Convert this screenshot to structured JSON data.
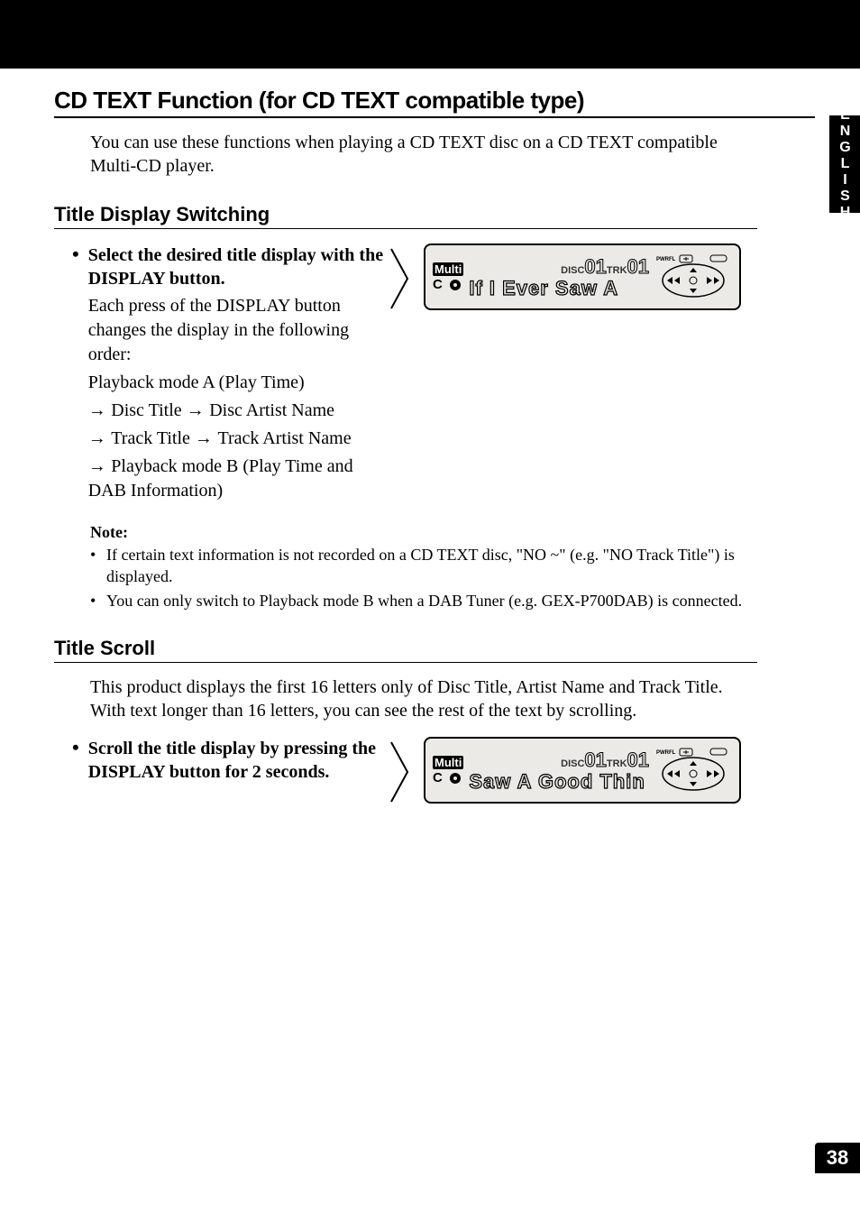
{
  "sidebar": {
    "language": "ENGLISH"
  },
  "page_number": "38",
  "main_heading": "CD TEXT Function (for CD TEXT compatible type)",
  "intro": "You can use these functions when playing a CD TEXT disc on a CD TEXT compatible Multi-CD player.",
  "section1": {
    "heading": "Title Display Switching",
    "bullet_heading": "Select the desired title display with the DISPLAY button.",
    "body1": "Each press of the DISPLAY button changes the display in the following order:",
    "line_a": "Playback mode A (Play Time)",
    "seq1a": "Disc Title",
    "seq1b": "Disc Artist Name",
    "seq2a": "Track Title",
    "seq2b": "Track Artist Name",
    "seq3": "Playback mode B (Play Time and DAB Information)",
    "lcd": {
      "multi": "Multi",
      "cd": "C",
      "disc_lbl": "DISC",
      "disc_num": "01",
      "trk_lbl": "TRK",
      "trk_num": "01",
      "title": "If I Ever Saw A",
      "pwrfl": "PWRFL"
    }
  },
  "note": {
    "heading": "Note:",
    "items": [
      "If certain text information is not recorded on a CD TEXT disc, \"NO ~\" (e.g. \"NO Track Title\") is displayed.",
      "You can only switch to Playback mode B when a DAB Tuner (e.g. GEX-P700DAB) is connected."
    ]
  },
  "section2": {
    "heading": "Title Scroll",
    "intro": "This product displays the first 16 letters only of Disc Title, Artist Name and Track Title. With text longer than 16 letters, you can see the rest of the text by scrolling.",
    "bullet_heading": "Scroll the title display by pressing the DISPLAY button for 2 seconds.",
    "lcd": {
      "multi": "Multi",
      "cd": "C",
      "disc_lbl": "DISC",
      "disc_num": "01",
      "trk_lbl": "TRK",
      "trk_num": "01",
      "title": "Saw A Good Thin",
      "pwrfl": "PWRFL"
    }
  }
}
